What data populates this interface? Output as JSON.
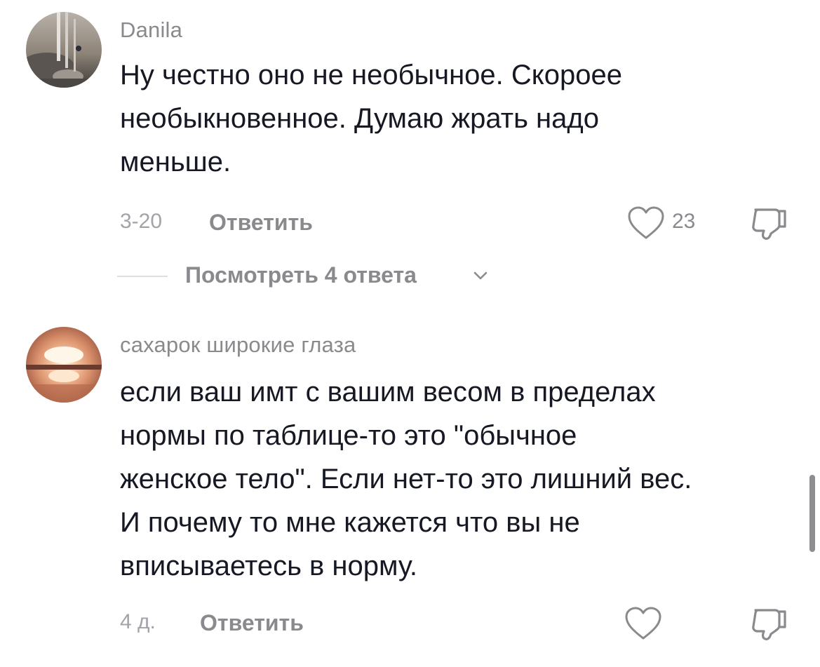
{
  "comments": [
    {
      "author": "Danila",
      "avatar_icon": "avatar-photo-icon",
      "lines": [
        "Ну честно оно не необычное. Скороее",
        "необыкновенное. Думаю жрать надо",
        "меньше."
      ],
      "date": "3-20",
      "reply_label": "Ответить",
      "like_count": "23",
      "view_replies_label": "Посмотреть 4 ответа"
    },
    {
      "author": "сахарок широкие глаза",
      "avatar_icon": "avatar-sunset-icon",
      "lines": [
        "если ваш имт с вашим весом в пределах",
        "нормы по таблице-то это \"обычное",
        "женское тело\". Если нет-то это лишний вес.",
        "И почему то мне кажется что вы не",
        "вписываетесь в норму."
      ],
      "date": "4 д.",
      "reply_label": "Ответить"
    }
  ],
  "icons": {
    "like": "heart-outline-icon",
    "dislike": "thumbs-down-icon",
    "chevron": "chevron-down-icon"
  },
  "colors": {
    "text": "#161823",
    "secondary": "#8a8a8e",
    "background": "#ffffff"
  }
}
